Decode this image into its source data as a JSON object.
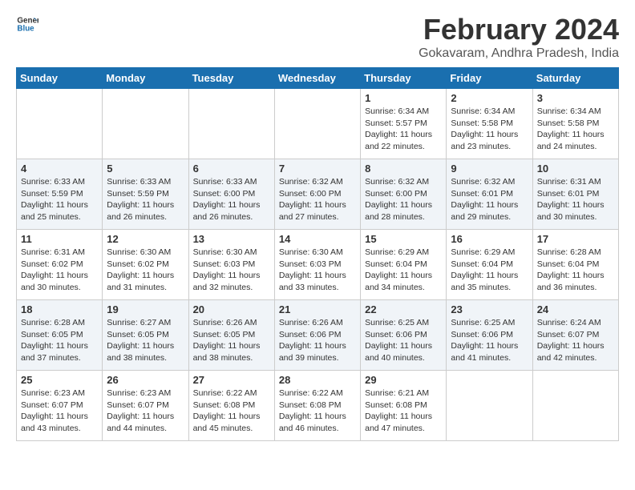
{
  "header": {
    "logo_general": "General",
    "logo_blue": "Blue",
    "main_title": "February 2024",
    "subtitle": "Gokavaram, Andhra Pradesh, India"
  },
  "columns": [
    "Sunday",
    "Monday",
    "Tuesday",
    "Wednesday",
    "Thursday",
    "Friday",
    "Saturday"
  ],
  "weeks": [
    [
      {
        "day": "",
        "info": ""
      },
      {
        "day": "",
        "info": ""
      },
      {
        "day": "",
        "info": ""
      },
      {
        "day": "",
        "info": ""
      },
      {
        "day": "1",
        "info": "Sunrise: 6:34 AM\nSunset: 5:57 PM\nDaylight: 11 hours and 22 minutes."
      },
      {
        "day": "2",
        "info": "Sunrise: 6:34 AM\nSunset: 5:58 PM\nDaylight: 11 hours and 23 minutes."
      },
      {
        "day": "3",
        "info": "Sunrise: 6:34 AM\nSunset: 5:58 PM\nDaylight: 11 hours and 24 minutes."
      }
    ],
    [
      {
        "day": "4",
        "info": "Sunrise: 6:33 AM\nSunset: 5:59 PM\nDaylight: 11 hours and 25 minutes."
      },
      {
        "day": "5",
        "info": "Sunrise: 6:33 AM\nSunset: 5:59 PM\nDaylight: 11 hours and 26 minutes."
      },
      {
        "day": "6",
        "info": "Sunrise: 6:33 AM\nSunset: 6:00 PM\nDaylight: 11 hours and 26 minutes."
      },
      {
        "day": "7",
        "info": "Sunrise: 6:32 AM\nSunset: 6:00 PM\nDaylight: 11 hours and 27 minutes."
      },
      {
        "day": "8",
        "info": "Sunrise: 6:32 AM\nSunset: 6:00 PM\nDaylight: 11 hours and 28 minutes."
      },
      {
        "day": "9",
        "info": "Sunrise: 6:32 AM\nSunset: 6:01 PM\nDaylight: 11 hours and 29 minutes."
      },
      {
        "day": "10",
        "info": "Sunrise: 6:31 AM\nSunset: 6:01 PM\nDaylight: 11 hours and 30 minutes."
      }
    ],
    [
      {
        "day": "11",
        "info": "Sunrise: 6:31 AM\nSunset: 6:02 PM\nDaylight: 11 hours and 30 minutes."
      },
      {
        "day": "12",
        "info": "Sunrise: 6:30 AM\nSunset: 6:02 PM\nDaylight: 11 hours and 31 minutes."
      },
      {
        "day": "13",
        "info": "Sunrise: 6:30 AM\nSunset: 6:03 PM\nDaylight: 11 hours and 32 minutes."
      },
      {
        "day": "14",
        "info": "Sunrise: 6:30 AM\nSunset: 6:03 PM\nDaylight: 11 hours and 33 minutes."
      },
      {
        "day": "15",
        "info": "Sunrise: 6:29 AM\nSunset: 6:04 PM\nDaylight: 11 hours and 34 minutes."
      },
      {
        "day": "16",
        "info": "Sunrise: 6:29 AM\nSunset: 6:04 PM\nDaylight: 11 hours and 35 minutes."
      },
      {
        "day": "17",
        "info": "Sunrise: 6:28 AM\nSunset: 6:04 PM\nDaylight: 11 hours and 36 minutes."
      }
    ],
    [
      {
        "day": "18",
        "info": "Sunrise: 6:28 AM\nSunset: 6:05 PM\nDaylight: 11 hours and 37 minutes."
      },
      {
        "day": "19",
        "info": "Sunrise: 6:27 AM\nSunset: 6:05 PM\nDaylight: 11 hours and 38 minutes."
      },
      {
        "day": "20",
        "info": "Sunrise: 6:26 AM\nSunset: 6:05 PM\nDaylight: 11 hours and 38 minutes."
      },
      {
        "day": "21",
        "info": "Sunrise: 6:26 AM\nSunset: 6:06 PM\nDaylight: 11 hours and 39 minutes."
      },
      {
        "day": "22",
        "info": "Sunrise: 6:25 AM\nSunset: 6:06 PM\nDaylight: 11 hours and 40 minutes."
      },
      {
        "day": "23",
        "info": "Sunrise: 6:25 AM\nSunset: 6:06 PM\nDaylight: 11 hours and 41 minutes."
      },
      {
        "day": "24",
        "info": "Sunrise: 6:24 AM\nSunset: 6:07 PM\nDaylight: 11 hours and 42 minutes."
      }
    ],
    [
      {
        "day": "25",
        "info": "Sunrise: 6:23 AM\nSunset: 6:07 PM\nDaylight: 11 hours and 43 minutes."
      },
      {
        "day": "26",
        "info": "Sunrise: 6:23 AM\nSunset: 6:07 PM\nDaylight: 11 hours and 44 minutes."
      },
      {
        "day": "27",
        "info": "Sunrise: 6:22 AM\nSunset: 6:08 PM\nDaylight: 11 hours and 45 minutes."
      },
      {
        "day": "28",
        "info": "Sunrise: 6:22 AM\nSunset: 6:08 PM\nDaylight: 11 hours and 46 minutes."
      },
      {
        "day": "29",
        "info": "Sunrise: 6:21 AM\nSunset: 6:08 PM\nDaylight: 11 hours and 47 minutes."
      },
      {
        "day": "",
        "info": ""
      },
      {
        "day": "",
        "info": ""
      }
    ]
  ]
}
